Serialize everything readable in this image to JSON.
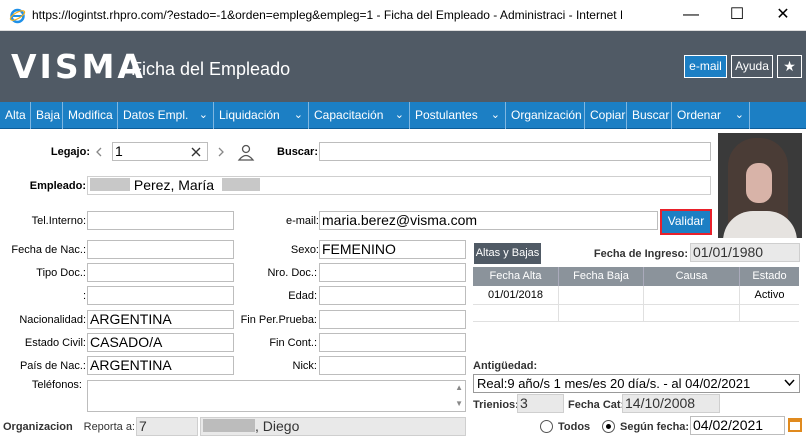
{
  "window": {
    "title": "https://logintst.rhpro.com/?estado=-1&orden=empleg&empleg=1 - Ficha del Empleado - Administraci - Internet Expl...",
    "minimize": "—",
    "maximize": "☐",
    "close": "✕"
  },
  "header": {
    "logo": "VISMA",
    "title": "Ficha del Empleado",
    "email_label": "e-mail",
    "ayuda_label": "Ayuda",
    "star": "★"
  },
  "menu": {
    "items": [
      "Alta",
      "Baja",
      "Modifica",
      "Datos Empl.",
      "Liquidación",
      "Capacitación",
      "Postulantes",
      "Organización",
      "Copiar",
      "Buscar",
      "Ordenar"
    ],
    "chevron": "⌄"
  },
  "form": {
    "legajo_label": "Legajo:",
    "legajo_value": "1",
    "buscar_label": "Buscar:",
    "buscar_value": "",
    "empleado_label": "Empleado:",
    "empleado_value": "Perez, María",
    "telinterno_label": "Tel.Interno:",
    "telinterno_value": "",
    "email_label": "e-mail:",
    "email_value": "maria.berez@visma.com",
    "validar_label": "Validar",
    "fechanac_label": "Fecha de Nac.:",
    "fechanac_value": "",
    "sexo_label": "Sexo:",
    "sexo_value": "FEMENINO",
    "tipodoc_label": "Tipo Doc.:",
    "tipodoc_value": "",
    "nrodoc_label": "Nro. Doc.:",
    "nrodoc_value": "",
    "colon_label": ":",
    "edad_label": "Edad:",
    "edad_value": "",
    "nacionalidad_label": "Nacionalidad:",
    "nacionalidad_value": "ARGENTINA",
    "finprueba_label": "Fin Per.Prueba:",
    "finprueba_value": "",
    "estadocivil_label": "Estado Civil:",
    "estadocivil_value": "CASADO/A",
    "fincont_label": "Fin Cont.:",
    "fincont_value": "",
    "paisnac_label": "País de Nac.:",
    "paisnac_value": "ARGENTINA",
    "nick_label": "Nick:",
    "nick_value": "",
    "telefonos_label": "Teléfonos:",
    "organizacion_label": "Organizacion",
    "reporta_label": "Reporta a:",
    "reporta_value": "7",
    "reporta_name": ", Diego"
  },
  "altas": {
    "button": "Altas y Bajas",
    "fecha_ingreso_label": "Fecha de Ingreso:",
    "fecha_ingreso_value": "01/01/1980",
    "columns": [
      "Fecha Alta",
      "Fecha Baja",
      "Causa",
      "Estado"
    ],
    "rows": [
      [
        "01/01/2018",
        "",
        "",
        "Activo"
      ]
    ]
  },
  "antiguedad": {
    "label": "Antigüedad:",
    "value": "Real:9 año/s 1 mes/es 20 día/s. - al 04/02/2021",
    "trienios_label": "Trienios:",
    "trienios_value": "3",
    "fechacat_label": "Fecha Cat:",
    "fechacat_value": "14/10/2008",
    "todos_label": "Todos",
    "segun_label": "Según fecha:",
    "segun_value": "04/02/2021"
  }
}
